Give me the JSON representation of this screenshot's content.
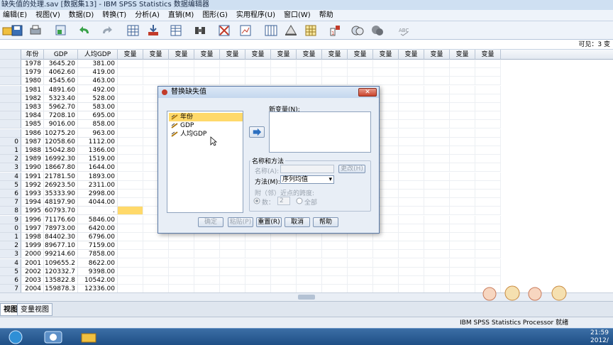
{
  "window": {
    "title": "缺失值的处理.sav [数据集13] - IBM SPSS Statistics 数据编辑器"
  },
  "menu": [
    "编辑(E)",
    "视图(V)",
    "数据(D)",
    "转换(T)",
    "分析(A)",
    "直销(M)",
    "图形(G)",
    "实用程序(U)",
    "窗口(W)",
    "帮助"
  ],
  "visible_text": "可见：3 变",
  "columns": [
    "年份",
    "GDP",
    "人均GDP",
    "变量",
    "变量",
    "变量",
    "变量",
    "变量",
    "变量",
    "变量",
    "变量",
    "变量",
    "变量",
    "变量",
    "变量",
    "变量",
    "变量",
    "变量"
  ],
  "rows": [
    [
      "1978",
      "3645.20",
      "381.00"
    ],
    [
      "1979",
      "4062.60",
      "419.00"
    ],
    [
      "1980",
      "4545.60",
      "463.00"
    ],
    [
      "1981",
      "4891.60",
      "492.00"
    ],
    [
      "1982",
      "5323.40",
      "528.00"
    ],
    [
      "1983",
      "5962.70",
      "583.00"
    ],
    [
      "1984",
      "7208.10",
      "695.00"
    ],
    [
      "1985",
      "9016.00",
      "858.00"
    ],
    [
      "1986",
      "10275.20",
      "963.00"
    ],
    [
      "1987",
      "12058.60",
      "1112.00"
    ],
    [
      "1988",
      "15042.80",
      "1366.00"
    ],
    [
      "1989",
      "16992.30",
      "1519.00"
    ],
    [
      "1990",
      "18667.80",
      "1644.00"
    ],
    [
      "1991",
      "21781.50",
      "1893.00"
    ],
    [
      "1992",
      "26923.50",
      "2311.00"
    ],
    [
      "1993",
      "35333.90",
      "2998.00"
    ],
    [
      "1994",
      "48197.90",
      "4044.00"
    ],
    [
      "1995",
      "60793.70",
      "."
    ],
    [
      "1996",
      "71176.60",
      "5846.00"
    ],
    [
      "1997",
      "78973.00",
      "6420.00"
    ],
    [
      "1998",
      "84402.30",
      "6796.00"
    ],
    [
      "1999",
      "89677.10",
      "7159.00"
    ],
    [
      "2000",
      "99214.60",
      "7858.00"
    ],
    [
      "2001",
      "109655.2",
      "8622.00"
    ],
    [
      "2002",
      "120332.7",
      "9398.00"
    ],
    [
      "2003",
      "135822.8",
      "10542.00"
    ],
    [
      "2004",
      "159878.3",
      "12336.00"
    ]
  ],
  "row_numbers": [
    "",
    "",
    "",
    "",
    "",
    "",
    "",
    "",
    "",
    "0",
    "1",
    "2",
    "3",
    "4",
    "5",
    "6",
    "7",
    "8",
    "9",
    "0",
    "1",
    "2",
    "3",
    "4",
    "5",
    "6",
    "7"
  ],
  "tabs": [
    "视图",
    "变量视图"
  ],
  "status": {
    "processor": "IBM SPSS Statistics Processor 就绪"
  },
  "clock": {
    "time": "21:59",
    "date": "2012/"
  },
  "dialog": {
    "title": "替换缺失值",
    "close": "✕",
    "variables": [
      "年份",
      "GDP",
      "人均GDP"
    ],
    "new_var_label": "新变量(N):",
    "group_label": "名称和方法",
    "name_label": "名称(A):",
    "change_btn": "更改(H)",
    "method_label": "方法(M):",
    "method_value": "序列均值",
    "span_label": "附（邻）近点的跨度:",
    "number_label": "数：",
    "number_value": "2",
    "all_label": "全部",
    "buttons": [
      "确定",
      "粘贴(P)",
      "重置(R)",
      "取消",
      "帮助"
    ]
  },
  "colors": {
    "accent": "#ffd96a",
    "dialog_bg": "#e8eef6",
    "title_bg": "#cfe0f2"
  }
}
